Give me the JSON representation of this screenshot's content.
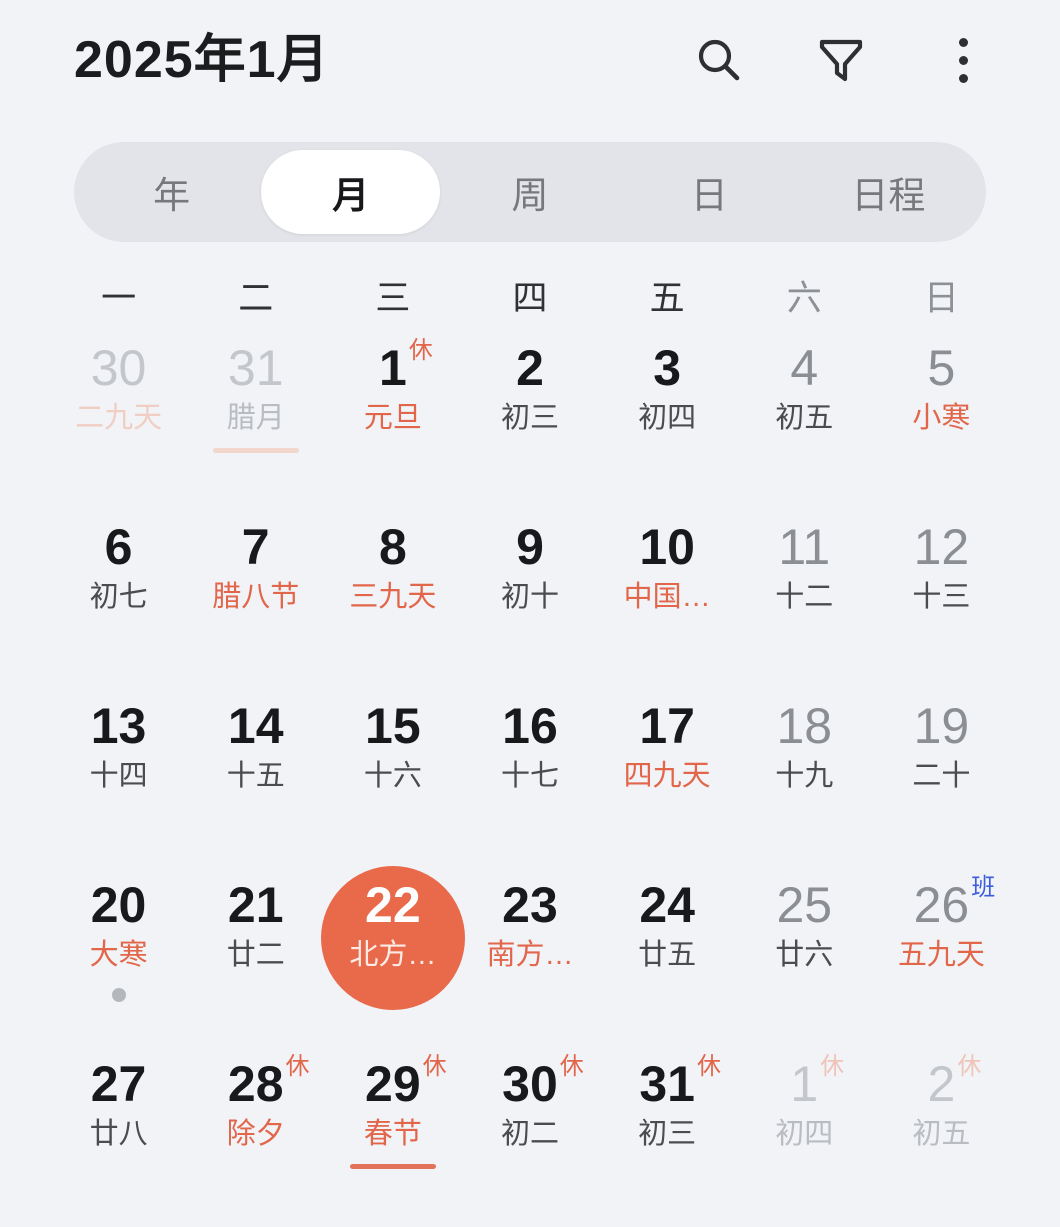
{
  "app": {
    "title": "2025年1月",
    "accent_color": "#e86a4b",
    "rest_color": "#e2664a",
    "work_color": "#3b5edb",
    "background": "#f1f3f7"
  },
  "header": {
    "title": "2025年1月",
    "actions": [
      {
        "name": "search-icon",
        "label": "搜索"
      },
      {
        "name": "filter-icon",
        "label": "筛选"
      },
      {
        "name": "more-icon",
        "label": "更多"
      }
    ]
  },
  "view_tabs": {
    "active": "月",
    "items": [
      {
        "label": "年",
        "active": false
      },
      {
        "label": "月",
        "active": true
      },
      {
        "label": "周",
        "active": false
      },
      {
        "label": "日",
        "active": false
      },
      {
        "label": "日程",
        "active": false
      }
    ]
  },
  "weekdays": [
    {
      "label": "一",
      "weekend": false
    },
    {
      "label": "二",
      "weekend": false
    },
    {
      "label": "三",
      "weekend": false
    },
    {
      "label": "四",
      "weekend": false
    },
    {
      "label": "五",
      "weekend": false
    },
    {
      "label": "六",
      "weekend": true
    },
    {
      "label": "日",
      "weekend": true
    }
  ],
  "calendar": {
    "year": 2025,
    "month": 1,
    "selected_day": 22,
    "days": [
      {
        "num": "30",
        "sub": "二九天",
        "num_style": "faded",
        "sub_style": "pink",
        "badge": null,
        "badge_style": null,
        "underline": null,
        "dot": false,
        "selected": false
      },
      {
        "num": "31",
        "sub": "腊月",
        "num_style": "faded",
        "sub_style": "gray",
        "badge": null,
        "badge_style": null,
        "underline": "pink",
        "dot": false,
        "selected": false
      },
      {
        "num": "1",
        "sub": "元旦",
        "num_style": "dark",
        "sub_style": "red",
        "badge": "休",
        "badge_style": "rest",
        "underline": null,
        "dot": false,
        "selected": false
      },
      {
        "num": "2",
        "sub": "初三",
        "num_style": "dark",
        "sub_style": "normal",
        "badge": null,
        "badge_style": null,
        "underline": null,
        "dot": false,
        "selected": false
      },
      {
        "num": "3",
        "sub": "初四",
        "num_style": "dark",
        "sub_style": "normal",
        "badge": null,
        "badge_style": null,
        "underline": null,
        "dot": false,
        "selected": false
      },
      {
        "num": "4",
        "sub": "初五",
        "num_style": "gray",
        "sub_style": "normal",
        "badge": null,
        "badge_style": null,
        "underline": null,
        "dot": false,
        "selected": false
      },
      {
        "num": "5",
        "sub": "小寒",
        "num_style": "gray",
        "sub_style": "red",
        "badge": null,
        "badge_style": null,
        "underline": null,
        "dot": false,
        "selected": false
      },
      {
        "num": "6",
        "sub": "初七",
        "num_style": "dark",
        "sub_style": "normal",
        "badge": null,
        "badge_style": null,
        "underline": null,
        "dot": false,
        "selected": false
      },
      {
        "num": "7",
        "sub": "腊八节",
        "num_style": "dark",
        "sub_style": "red",
        "badge": null,
        "badge_style": null,
        "underline": null,
        "dot": false,
        "selected": false
      },
      {
        "num": "8",
        "sub": "三九天",
        "num_style": "dark",
        "sub_style": "red",
        "badge": null,
        "badge_style": null,
        "underline": null,
        "dot": false,
        "selected": false
      },
      {
        "num": "9",
        "sub": "初十",
        "num_style": "dark",
        "sub_style": "normal",
        "badge": null,
        "badge_style": null,
        "underline": null,
        "dot": false,
        "selected": false
      },
      {
        "num": "10",
        "sub": "中国…",
        "num_style": "dark",
        "sub_style": "red",
        "badge": null,
        "badge_style": null,
        "underline": null,
        "dot": false,
        "selected": false
      },
      {
        "num": "11",
        "sub": "十二",
        "num_style": "gray",
        "sub_style": "normal",
        "badge": null,
        "badge_style": null,
        "underline": null,
        "dot": false,
        "selected": false
      },
      {
        "num": "12",
        "sub": "十三",
        "num_style": "gray",
        "sub_style": "normal",
        "badge": null,
        "badge_style": null,
        "underline": null,
        "dot": false,
        "selected": false
      },
      {
        "num": "13",
        "sub": "十四",
        "num_style": "dark",
        "sub_style": "normal",
        "badge": null,
        "badge_style": null,
        "underline": null,
        "dot": false,
        "selected": false
      },
      {
        "num": "14",
        "sub": "十五",
        "num_style": "dark",
        "sub_style": "normal",
        "badge": null,
        "badge_style": null,
        "underline": null,
        "dot": false,
        "selected": false
      },
      {
        "num": "15",
        "sub": "十六",
        "num_style": "dark",
        "sub_style": "normal",
        "badge": null,
        "badge_style": null,
        "underline": null,
        "dot": false,
        "selected": false
      },
      {
        "num": "16",
        "sub": "十七",
        "num_style": "dark",
        "sub_style": "normal",
        "badge": null,
        "badge_style": null,
        "underline": null,
        "dot": false,
        "selected": false
      },
      {
        "num": "17",
        "sub": "四九天",
        "num_style": "dark",
        "sub_style": "red",
        "badge": null,
        "badge_style": null,
        "underline": null,
        "dot": false,
        "selected": false
      },
      {
        "num": "18",
        "sub": "十九",
        "num_style": "gray",
        "sub_style": "normal",
        "badge": null,
        "badge_style": null,
        "underline": null,
        "dot": false,
        "selected": false
      },
      {
        "num": "19",
        "sub": "二十",
        "num_style": "gray",
        "sub_style": "normal",
        "badge": null,
        "badge_style": null,
        "underline": null,
        "dot": false,
        "selected": false
      },
      {
        "num": "20",
        "sub": "大寒",
        "num_style": "dark",
        "sub_style": "red",
        "badge": null,
        "badge_style": null,
        "underline": null,
        "dot": true,
        "selected": false
      },
      {
        "num": "21",
        "sub": "廿二",
        "num_style": "dark",
        "sub_style": "normal",
        "badge": null,
        "badge_style": null,
        "underline": null,
        "dot": false,
        "selected": false
      },
      {
        "num": "22",
        "sub": "北方…",
        "num_style": "dark",
        "sub_style": "red",
        "badge": null,
        "badge_style": null,
        "underline": null,
        "dot": false,
        "selected": true
      },
      {
        "num": "23",
        "sub": "南方…",
        "num_style": "dark",
        "sub_style": "red",
        "badge": null,
        "badge_style": null,
        "underline": null,
        "dot": false,
        "selected": false
      },
      {
        "num": "24",
        "sub": "廿五",
        "num_style": "dark",
        "sub_style": "normal",
        "badge": null,
        "badge_style": null,
        "underline": null,
        "dot": false,
        "selected": false
      },
      {
        "num": "25",
        "sub": "廿六",
        "num_style": "gray",
        "sub_style": "normal",
        "badge": null,
        "badge_style": null,
        "underline": null,
        "dot": false,
        "selected": false
      },
      {
        "num": "26",
        "sub": "五九天",
        "num_style": "gray",
        "sub_style": "red",
        "badge": "班",
        "badge_style": "work",
        "underline": null,
        "dot": false,
        "selected": false
      },
      {
        "num": "27",
        "sub": "廿八",
        "num_style": "dark",
        "sub_style": "normal",
        "badge": null,
        "badge_style": null,
        "underline": null,
        "dot": false,
        "selected": false
      },
      {
        "num": "28",
        "sub": "除夕",
        "num_style": "dark",
        "sub_style": "red",
        "badge": "休",
        "badge_style": "rest",
        "underline": null,
        "dot": false,
        "selected": false
      },
      {
        "num": "29",
        "sub": "春节",
        "num_style": "dark",
        "sub_style": "red",
        "badge": "休",
        "badge_style": "rest",
        "underline": "red",
        "dot": false,
        "selected": false
      },
      {
        "num": "30",
        "sub": "初二",
        "num_style": "dark",
        "sub_style": "normal",
        "badge": "休",
        "badge_style": "rest",
        "underline": null,
        "dot": false,
        "selected": false
      },
      {
        "num": "31",
        "sub": "初三",
        "num_style": "dark",
        "sub_style": "normal",
        "badge": "休",
        "badge_style": "rest",
        "underline": null,
        "dot": false,
        "selected": false
      },
      {
        "num": "1",
        "sub": "初四",
        "num_style": "faded",
        "sub_style": "gray",
        "badge": "休",
        "badge_style": "rest-faded",
        "underline": null,
        "dot": false,
        "selected": false
      },
      {
        "num": "2",
        "sub": "初五",
        "num_style": "faded",
        "sub_style": "gray",
        "badge": "休",
        "badge_style": "rest-faded",
        "underline": null,
        "dot": false,
        "selected": false
      }
    ]
  }
}
